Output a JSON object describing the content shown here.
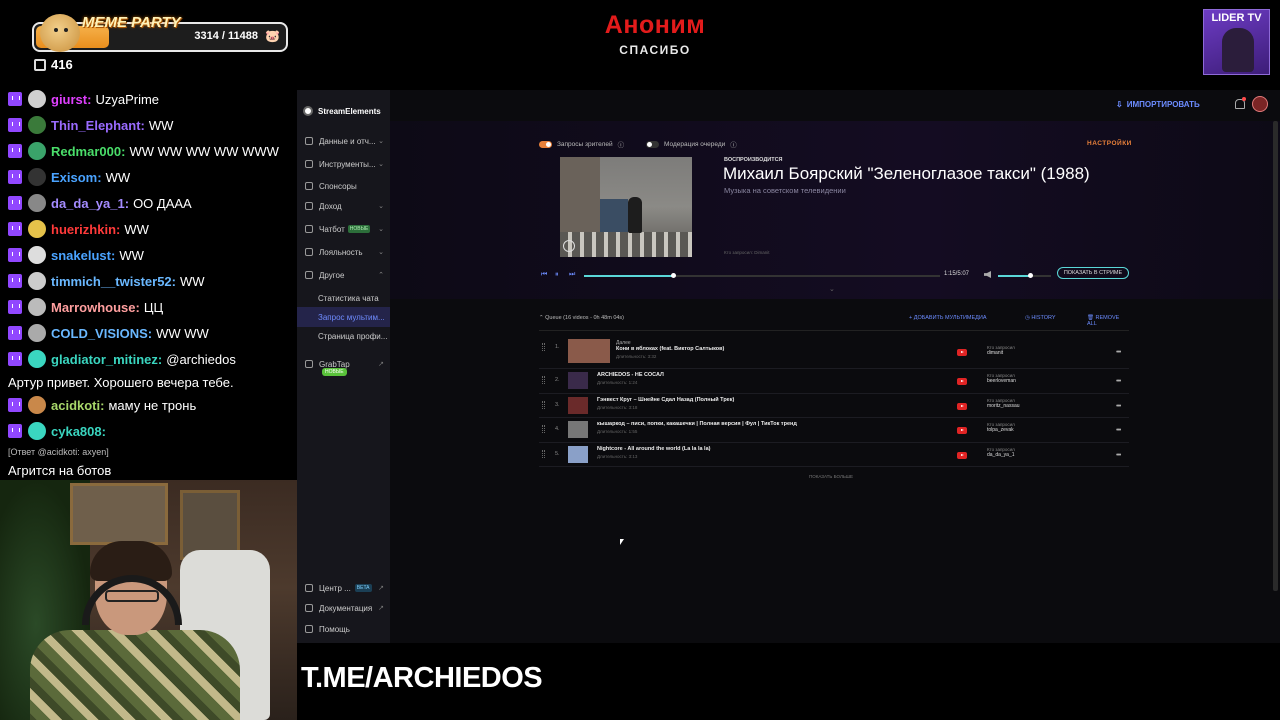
{
  "overlay": {
    "meme_title": "MEME PARTY",
    "meme_count": "3314 / 11488",
    "meme_progress": 0.29,
    "viewers": "416",
    "alert_name": "Аноним",
    "alert_sub": "СПАСИБО",
    "lider_title": "LIDER TV",
    "tme": "T.ME/ARCHIEDOS"
  },
  "chat": {
    "messages": [
      {
        "user": "giurst:",
        "text": "UzyaPrime",
        "color": "#e040ff"
      },
      {
        "user": "Thin_Elephant:",
        "text": "WW",
        "color": "#9a6bff"
      },
      {
        "user": "Redmar000:",
        "text": "WW WW WW WW WWW",
        "color": "#4ade6a"
      },
      {
        "user": "Exisom:",
        "text": "WW",
        "color": "#4aa3ff"
      },
      {
        "user": "da_da_ya_1:",
        "text": "ОО ДААА",
        "color": "#a48bff"
      },
      {
        "user": "huerizhkin:",
        "text": "WW",
        "color": "#ff3a3a"
      },
      {
        "user": "snakelust:",
        "text": "WW",
        "color": "#4aa3ff"
      },
      {
        "user": "timmich__twister52:",
        "text": "WW",
        "color": "#6ab8ff"
      },
      {
        "user": "Marrowhouse:",
        "text": "ЦЦ",
        "color": "#ff9f9f"
      },
      {
        "user": "COLD_VISIONS:",
        "text": "WW WW",
        "color": "#6ab8ff"
      },
      {
        "user": "gladiator_mitinez:",
        "text": "@archiedos",
        "color": "#3ad6c0"
      },
      {
        "user": "acidkoti:",
        "text": "маму не тронь",
        "color": "#a8d86a"
      },
      {
        "user": "cyka808:",
        "text": "",
        "color": "#3ad6c0"
      }
    ],
    "continuation": "Артур привет. Хорошего вечера тебе.",
    "reply": "[Ответ @acidkoti: axyen]",
    "last_text": "Агрится на ботов"
  },
  "se": {
    "brand": "StreamElements",
    "nav": [
      {
        "label": "Данные и отч...",
        "arrow": "⌄"
      },
      {
        "label": "Инструменты...",
        "arrow": "⌄"
      },
      {
        "label": "Спонсоры",
        "arrow": ""
      },
      {
        "label": "Доход",
        "arrow": "⌄"
      },
      {
        "label": "Чатбот",
        "arrow": "⌄",
        "badge": "НОВЫЕ"
      },
      {
        "label": "Лояльность",
        "arrow": "⌄"
      },
      {
        "label": "Другое",
        "arrow": "⌃"
      }
    ],
    "sub_nav": [
      "Статистика чата",
      "Запрос мультим...",
      "Страница профи..."
    ],
    "grabtap": "GrabTap",
    "grabtap_badge": "НОВЫЕ",
    "footer_nav": [
      "Центр ...",
      "Документация",
      "Помощь"
    ],
    "beta": "BETA",
    "import_label": "ИМПОРТИРОВАТЬ",
    "toggles": [
      "Запросы зрителей",
      "Модерация очереди"
    ],
    "settings": "НАСТРОЙКИ",
    "now_label": "ВОСПРОИЗВОДИТСЯ",
    "now_title": "Михаил Боярский \"Зеленоглазое такси\" (1988)",
    "now_sub": "Музыка на советском телевидении",
    "now_req": "Кто запросил: Dimanit",
    "time": "1:15/5:07",
    "progress": 0.25,
    "volume": 0.6,
    "show_button": "ПОКАЗАТЬ В СТРИМЕ",
    "queue_title": "Queue (16 videos - 0h 48m 04s)",
    "add_media": "ДОБАВИТЬ МУЛЬТИМЕДИА",
    "history": "HISTORY",
    "remove_all": "REMOVE ALL",
    "next_label": "Далее",
    "requested_label": "Кто запросил",
    "queue": [
      {
        "num": "1.",
        "title": "Кони в яблоках (feat. Виктор Салтыков)",
        "dur": "Длительность: 3:32",
        "user": "dimanit"
      },
      {
        "num": "2.",
        "title": "ARCHIEDOS - НЕ СОСАЛ",
        "dur": "Длительность: 1:24",
        "user": "beerloveman"
      },
      {
        "num": "3.",
        "title": "Гэнвест Круг – Шнейне Сдал Назад (Полный Трек)",
        "dur": "Длительность: 3:18",
        "user": "moritz_nassau"
      },
      {
        "num": "4.",
        "title": "кышаркод – писи, попки, какашечки | Полная версия | Фул | ТикТок тренд",
        "dur": "Длительность: 1:55",
        "user": "tolpa_zevak"
      },
      {
        "num": "5.",
        "title": "Nightcore - All around the world (La la la la)",
        "dur": "Длительность: 3:13",
        "user": "da_da_ya_1"
      }
    ],
    "show_more": "ПОКАЗАТЬ БОЛЬШЕ"
  }
}
